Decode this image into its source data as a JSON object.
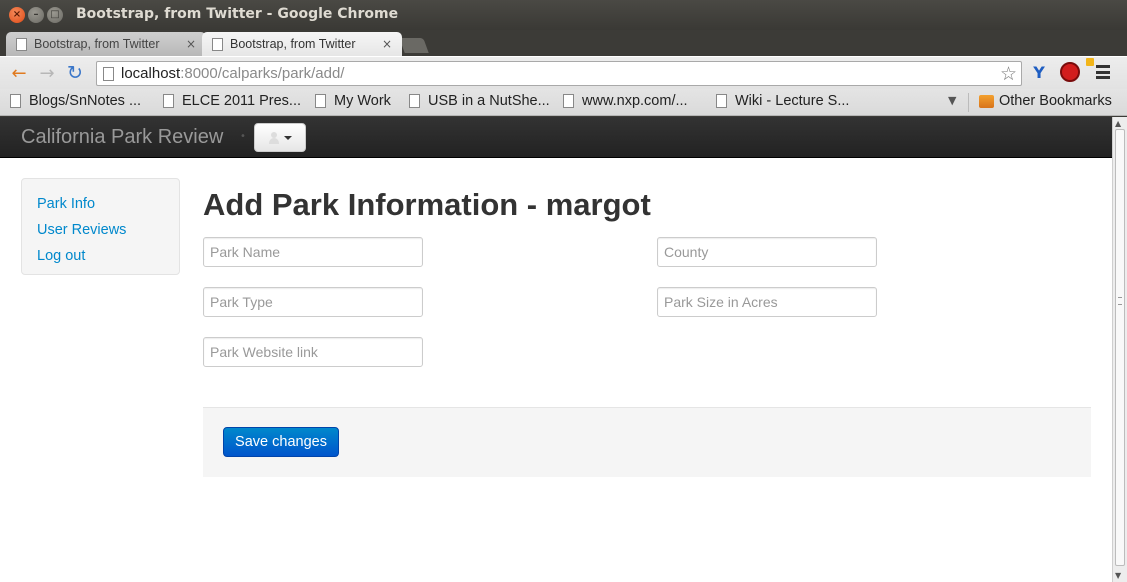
{
  "window": {
    "title": "Bootstrap, from Twitter - Google Chrome",
    "close_glyph": "×",
    "min_glyph": "–",
    "max_glyph": "□"
  },
  "tabs": [
    {
      "label": "Bootstrap, from Twitter",
      "close": "×",
      "active": false
    },
    {
      "label": "Bootstrap, from Twitter",
      "close": "×",
      "active": true
    }
  ],
  "toolbar": {
    "url_host": "localhost",
    "url_rest": ":8000/calparks/park/add/",
    "back_icon": "←",
    "forward_icon": "→",
    "reload_icon": "↻",
    "star_icon": "☆"
  },
  "bookmarks": {
    "items": [
      "Blogs/SnNotes ...",
      "ELCE 2011 Pres...",
      "My Work",
      "USB in a NutShe...",
      "www.nxp.com/...",
      "Wiki - Lecture S..."
    ],
    "more_icon": "▼",
    "other": "Other Bookmarks"
  },
  "page": {
    "brand": "California Park Review",
    "sidebar": [
      "Park Info",
      "User Reviews",
      "Log out"
    ],
    "title": "Add Park Information - margot",
    "fields": {
      "park_name": "Park Name",
      "county": "County",
      "park_type": "Park Type",
      "park_size": "Park Size in Acres",
      "park_website": "Park Website link"
    },
    "save_label": "Save changes"
  },
  "colors": {
    "link": "#0088cc",
    "primary_button": "#0055cc",
    "navbar": "#222222"
  }
}
